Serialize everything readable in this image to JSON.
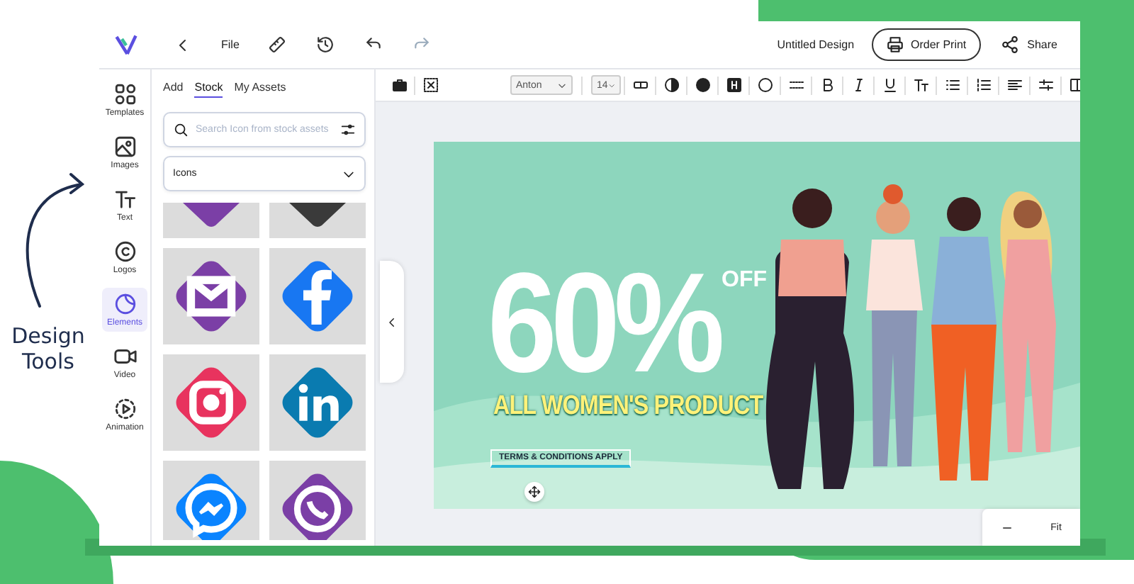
{
  "annotation": {
    "text": "Design Tools"
  },
  "topbar": {
    "menu": "File",
    "redo_disabled": true,
    "document_title": "Untitled Design",
    "order_button": "Order Print",
    "share_button": "Share"
  },
  "rail": [
    {
      "label": "Templates",
      "kind": "templates",
      "selected": false
    },
    {
      "label": "Images",
      "kind": "images",
      "selected": false
    },
    {
      "label": "Text",
      "kind": "text",
      "selected": false
    },
    {
      "label": "Logos",
      "kind": "logos",
      "selected": false
    },
    {
      "label": "Elements",
      "kind": "elements",
      "selected": true
    },
    {
      "label": "Video",
      "kind": "video",
      "selected": false
    },
    {
      "label": "Animation",
      "kind": "animation",
      "selected": false
    }
  ],
  "panel": {
    "tabs": [
      {
        "label": "Add",
        "selected": false
      },
      {
        "label": "Stock",
        "selected": true
      },
      {
        "label": "My Assets",
        "selected": false
      }
    ],
    "search": {
      "placeholder": "Search Icon from stock assets"
    },
    "category": "Icons",
    "tiles": [
      {
        "kind": "partial",
        "color": "#7b3fa6"
      },
      {
        "kind": "partial",
        "color": "#3a3a3a"
      },
      {
        "kind": "mail",
        "color": "#7b3fa6"
      },
      {
        "kind": "facebook",
        "color": "#1877f2"
      },
      {
        "kind": "instagram",
        "color": "#e8335e"
      },
      {
        "kind": "linkedin",
        "color": "#0a7bb0"
      },
      {
        "kind": "messenger",
        "color": "#0a84ff"
      },
      {
        "kind": "phone",
        "color": "#7b3fa6"
      }
    ]
  },
  "toolbar": {
    "font": "Anton",
    "size": "14"
  },
  "design": {
    "headline": "60%",
    "headline_suffix": "OFF",
    "subhead": "ALL WOMEN'S PRODUCT",
    "fine_print": "TERMS & CONDITIONS APPLY"
  },
  "zoom": {
    "label": "Fit"
  }
}
